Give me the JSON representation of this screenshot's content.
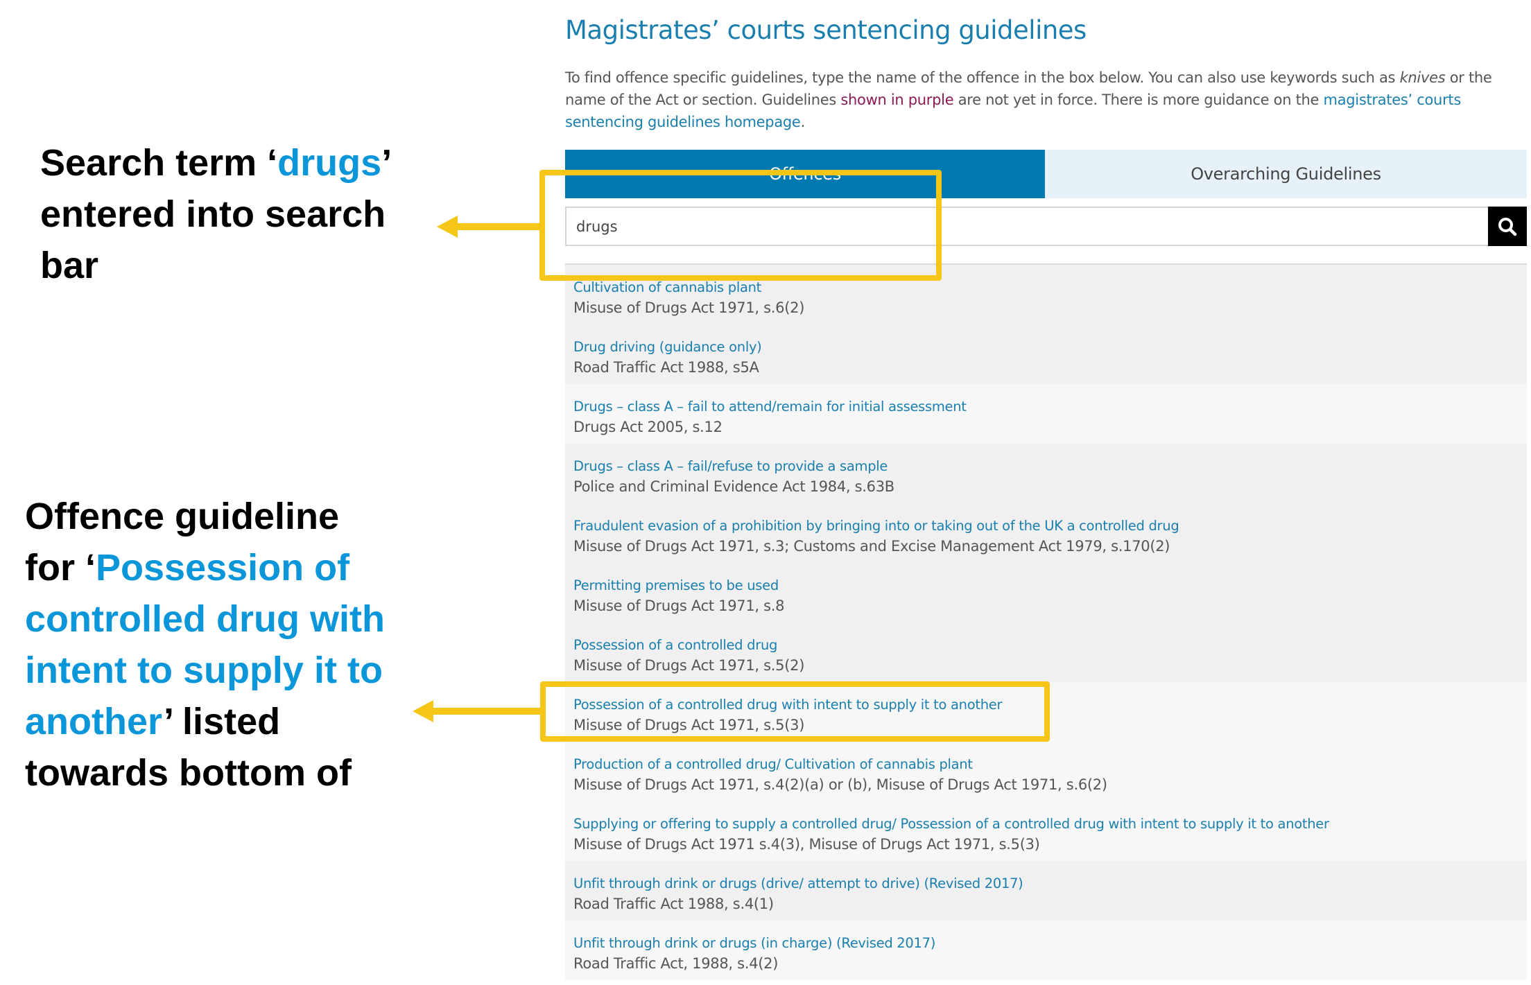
{
  "annotations": {
    "search": {
      "line1_prefix": "Search term ‘",
      "line1_highlight": "drugs",
      "line1_suffix": "’",
      "rest": "entered into search bar"
    },
    "result": {
      "prefix": "Offence guideline for ‘",
      "highlight": "Possession of controlled drug with intent to supply it to another",
      "suffix": "’ listed towards bottom of"
    },
    "highlight_color": "#f5c518",
    "accent_color": "#0a96d9"
  },
  "page": {
    "title": "Magistrates’ courts sentencing guidelines",
    "intro": {
      "part1": "To find offence specific guidelines, type the name of the offence in the box below. You can also use keywords such as ",
      "italic": "knives",
      "part2": " or the name of the Act or section. Guidelines ",
      "purple": "shown in purple",
      "part3": " are not yet in force. There is more guidance on the ",
      "link": "magistrates’ courts sentencing guidelines homepage",
      "part4": "."
    },
    "tabs": [
      {
        "label": "Offences",
        "active": true
      },
      {
        "label": "Overarching Guidelines",
        "active": false
      }
    ],
    "search": {
      "value": "drugs",
      "button_icon": "search-icon"
    },
    "results": [
      {
        "name": "Cultivation of cannabis plant",
        "act": "Misuse of Drugs Act 1971, s.6(2)",
        "shade": "grey"
      },
      {
        "name": "Drug driving (guidance only)",
        "act": "Road Traffic Act 1988, s5A",
        "shade": "grey"
      },
      {
        "name": "Drugs – class A – fail to attend/remain for initial assessment",
        "act": "Drugs Act 2005, s.12",
        "shade": "light"
      },
      {
        "name": "Drugs – class A – fail/refuse to provide a sample",
        "act": "Police and Criminal Evidence Act 1984, s.63B",
        "shade": "grey"
      },
      {
        "name": "Fraudulent evasion of a prohibition by bringing into or taking out of the UK a controlled drug",
        "act": "Misuse of Drugs Act 1971, s.3; Customs and Excise Management Act 1979, s.170(2)",
        "shade": "grey"
      },
      {
        "name": "Permitting premises to be used",
        "act": "Misuse of Drugs Act 1971, s.8",
        "shade": "grey"
      },
      {
        "name": "Possession of a controlled drug",
        "act": "Misuse of Drugs Act 1971, s.5(2)",
        "shade": "grey"
      },
      {
        "name": "Possession of a controlled drug with intent to supply it to another",
        "act": "Misuse of Drugs Act 1971, s.5(3)",
        "shade": "light"
      },
      {
        "name": "Production of a controlled drug/ Cultivation of cannabis plant",
        "act": "Misuse of Drugs Act 1971, s.4(2)(a) or (b), Misuse of Drugs Act 1971, s.6(2)",
        "shade": "light"
      },
      {
        "name": "Supplying or offering to supply a controlled drug/ Possession of a controlled drug with intent to supply it to another",
        "act": "Misuse of Drugs Act 1971 s.4(3), Misuse of Drugs Act 1971, s.5(3)",
        "shade": "light"
      },
      {
        "name": "Unfit through drink or drugs (drive/ attempt to drive) (Revised 2017)",
        "act": "Road Traffic Act 1988, s.4(1)",
        "shade": "grey"
      },
      {
        "name": "Unfit through drink or drugs (in charge) (Revised 2017)",
        "act": "Road Traffic Act, 1988, s.4(2)",
        "shade": "light"
      }
    ]
  }
}
